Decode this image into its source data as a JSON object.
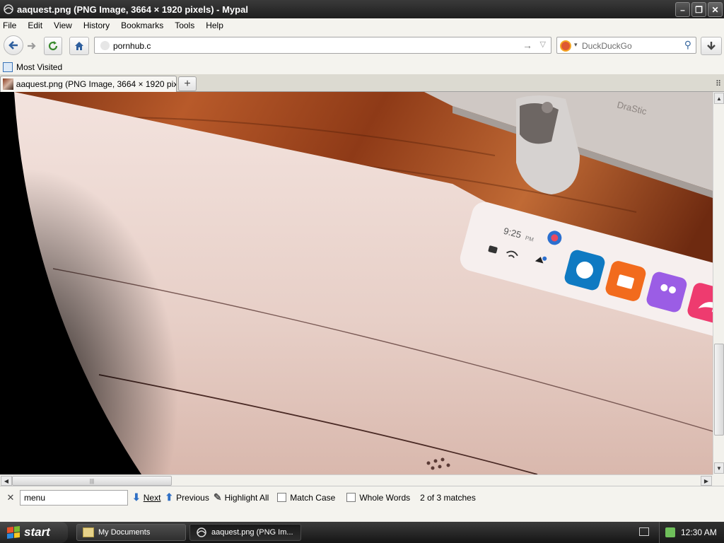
{
  "window": {
    "title": "aaquest.png (PNG Image, 3664 × 1920 pixels) - Mypal",
    "minimize": "–",
    "maximize": "❐",
    "close": "✕"
  },
  "menu": {
    "items": [
      "File",
      "Edit",
      "View",
      "History",
      "Bookmarks",
      "Tools",
      "Help"
    ]
  },
  "toolbar": {
    "url_value": "pornhub.c",
    "search_placeholder": "DuckDuckGo"
  },
  "bookmarks": {
    "items": [
      "Most Visited"
    ]
  },
  "tabs": {
    "items": [
      {
        "label": "aaquest.png (PNG Image, 3664 × 1920 pixe..."
      }
    ],
    "new_tab": "+"
  },
  "image_content": {
    "time": "9:25",
    "ampm": "PM",
    "sign_text": "DraStic"
  },
  "findbar": {
    "query": "menu",
    "next_label": "Next",
    "previous_label": "Previous",
    "highlight_all_label": "Highlight All",
    "match_case_label": "Match Case",
    "whole_words_label": "Whole Words",
    "status": "2 of 3 matches"
  },
  "taskbar": {
    "start_label": "start",
    "windows": [
      {
        "label": "My Documents"
      },
      {
        "label": "aaquest.png (PNG Im..."
      }
    ],
    "clock": "12:30 AM"
  }
}
